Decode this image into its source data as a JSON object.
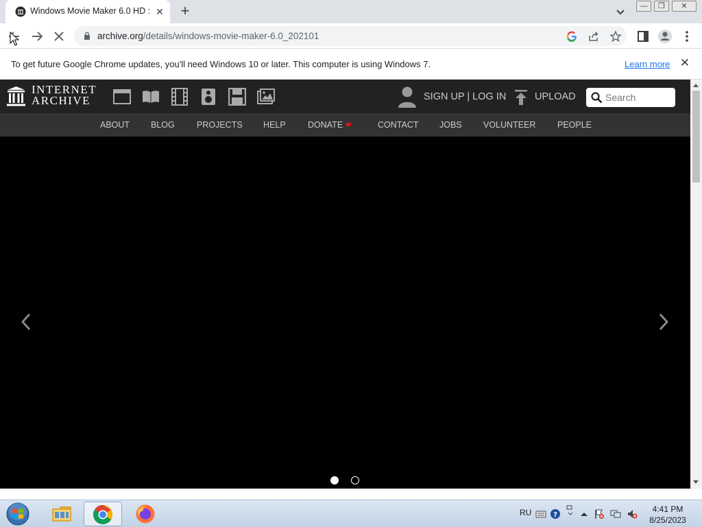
{
  "browser": {
    "tab_title": "Windows Movie Maker 6.0 HD : ",
    "url_host": "archive.org",
    "url_path": "/details/windows-movie-maker-6.0_202101",
    "window_buttons": {
      "minimize": "—",
      "maximize": "❐",
      "close": "✕"
    }
  },
  "infobar": {
    "message": "To get future Google Chrome updates, you'll need Windows 10 or later. This computer is using Windows 7.",
    "link": "Learn more"
  },
  "ia": {
    "logo_line1": "INTERNET",
    "logo_line2": "ARCHIVE",
    "media_icons": [
      "web-icon",
      "texts-icon",
      "video-icon",
      "audio-icon",
      "software-icon",
      "images-icon"
    ],
    "signup": "SIGN UP | LOG IN",
    "upload": "UPLOAD",
    "search_placeholder": "Search",
    "nav": [
      "ABOUT",
      "BLOG",
      "PROJECTS",
      "HELP",
      "DONATE",
      "CONTACT",
      "JOBS",
      "VOLUNTEER",
      "PEOPLE"
    ],
    "carousel": {
      "slides": 2,
      "active": 1
    }
  },
  "taskbar": {
    "apps": [
      "windows-explorer",
      "google-chrome",
      "firefox"
    ],
    "active_app": "google-chrome",
    "lang": "RU",
    "time": "4:41 PM",
    "date": "8/25/2023"
  },
  "colors": {
    "ia_header": "#222222",
    "ia_nav": "#333333",
    "page_bg": "#000000",
    "link_blue": "#1a73e8",
    "donate_heart": "#ee1111"
  }
}
